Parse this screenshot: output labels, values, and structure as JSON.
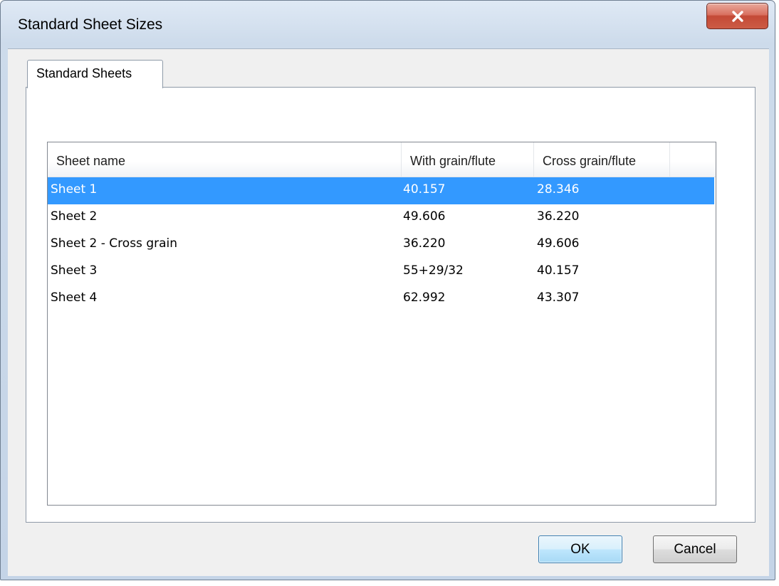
{
  "window": {
    "title": "Standard Sheet Sizes"
  },
  "tabs": [
    {
      "label": "Standard Sheets"
    }
  ],
  "table": {
    "columns": [
      "Sheet name",
      "With grain/flute",
      "Cross grain/flute"
    ],
    "rows": [
      {
        "name": "Sheet 1",
        "with_grain": "40.157",
        "cross_grain": "28.346",
        "selected": true
      },
      {
        "name": "Sheet 2",
        "with_grain": "49.606",
        "cross_grain": "36.220",
        "selected": false
      },
      {
        "name": "Sheet 2 - Cross grain",
        "with_grain": "36.220",
        "cross_grain": "49.606",
        "selected": false
      },
      {
        "name": "Sheet 3",
        "with_grain": "55+29/32",
        "cross_grain": "40.157",
        "selected": false
      },
      {
        "name": "Sheet 4",
        "with_grain": "62.992",
        "cross_grain": "43.307",
        "selected": false
      }
    ]
  },
  "buttons": {
    "ok_label": "OK",
    "cancel_label": "Cancel"
  },
  "icons": {
    "close": "close-icon"
  },
  "colors": {
    "selection": "#3399ff",
    "selection_text": "#ffffff",
    "close_button": "#c44a36"
  }
}
